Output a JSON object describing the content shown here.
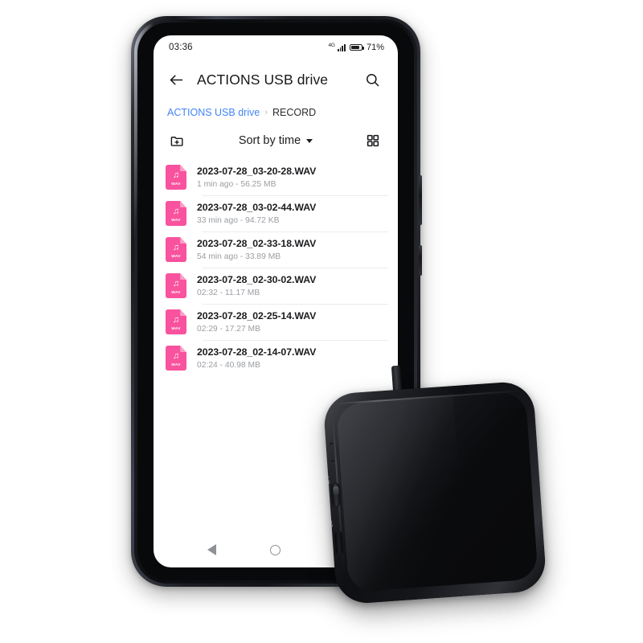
{
  "status_bar": {
    "time": "03:36",
    "network_type": "4G",
    "battery_percent": "71%",
    "battery_level": 71
  },
  "app_bar": {
    "back_icon": "arrow-left-icon",
    "title": "ACTIONS USB drive",
    "search_icon": "search-icon"
  },
  "breadcrumb": {
    "root": "ACTIONS USB drive",
    "separator": "›",
    "current": "RECORD"
  },
  "toolbar": {
    "new_folder_icon": "new-folder-icon",
    "sort_label": "Sort by time",
    "sort_caret": "caret-down-icon",
    "grid_view_icon": "grid-view-icon"
  },
  "files": [
    {
      "name": "2023-07-28_03-20-28.WAV",
      "meta": "1 min ago - 56.25 MB",
      "type": "WAV",
      "note": "♫"
    },
    {
      "name": "2023-07-28_03-02-44.WAV",
      "meta": "33 min ago - 94.72 KB",
      "type": "WAV",
      "note": "♫"
    },
    {
      "name": "2023-07-28_02-33-18.WAV",
      "meta": "54 min ago - 33.89 MB",
      "type": "WAV",
      "note": "♫"
    },
    {
      "name": "2023-07-28_02-30-02.WAV",
      "meta": "02:32 - 11.17 MB",
      "type": "WAV",
      "note": "♫"
    },
    {
      "name": "2023-07-28_02-25-14.WAV",
      "meta": "02:29 - 17.27 MB",
      "type": "WAV",
      "note": "♫"
    },
    {
      "name": "2023-07-28_02-14-07.WAV",
      "meta": "02:24 - 40.98 MB",
      "type": "WAV",
      "note": "♫"
    }
  ],
  "nav_bar": {
    "back_icon": "nav-back-icon",
    "home_icon": "nav-home-icon",
    "recents_icon": "nav-recents-icon"
  },
  "recorder_device": {
    "switch_off_label": "OFF",
    "switch_on_label": "ON"
  },
  "colors": {
    "accent_blue": "#4285f4",
    "wav_pink": "#f9529e",
    "wav_pink_light": "#fba0c8",
    "text_primary": "#1b1c1e",
    "text_secondary": "#9a9da2",
    "divider": "#ececee",
    "nav_icon": "#8e9196"
  }
}
